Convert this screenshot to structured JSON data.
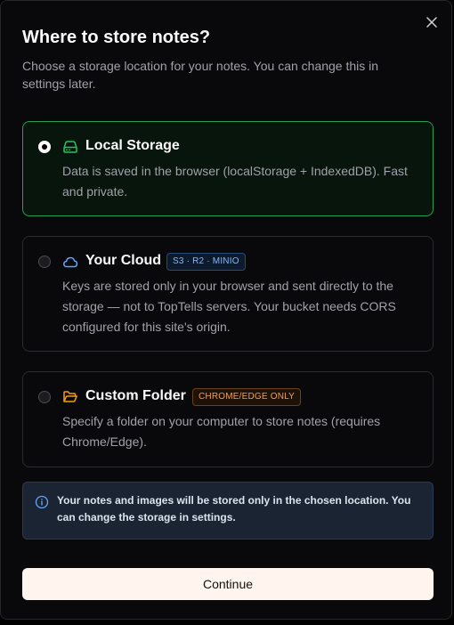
{
  "dialog": {
    "title": "Where to store notes?",
    "subtitle": "Choose a storage location for your notes. You can change this in settings later.",
    "close_icon": "close-icon"
  },
  "options": [
    {
      "id": "local",
      "title": "Local Storage",
      "description": "Data is saved in the browser (localStorage + IndexedDB). Fast and private.",
      "icon": "hard-drive-icon",
      "icon_color": "#22c55e",
      "selected": true
    },
    {
      "id": "cloud",
      "title": "Your Cloud",
      "badge": "S3 · R2 · MINIO",
      "description": "Keys are stored only in your browser and sent directly to the storage — not to TopTells servers. Your bucket needs CORS configured for this site's origin.",
      "icon": "cloud-icon",
      "icon_color": "#60a5fa",
      "selected": false
    },
    {
      "id": "folder",
      "title": "Custom Folder",
      "badge": "CHROME/EDGE ONLY",
      "description": "Specify a folder on your computer to store notes (requires Chrome/Edge).",
      "icon": "folder-open-icon",
      "icon_color": "#f59e0b",
      "selected": false
    }
  ],
  "info": {
    "icon": "info-icon",
    "text": "Your notes and images will be stored only in the chosen location. You can change the storage in settings."
  },
  "continue_label": "Continue",
  "colors": {
    "selected_border": "#22a05a",
    "cloud_badge": "#7fb8ff",
    "folder_badge": "#f0a050",
    "button_bg": "#fff5ee"
  }
}
